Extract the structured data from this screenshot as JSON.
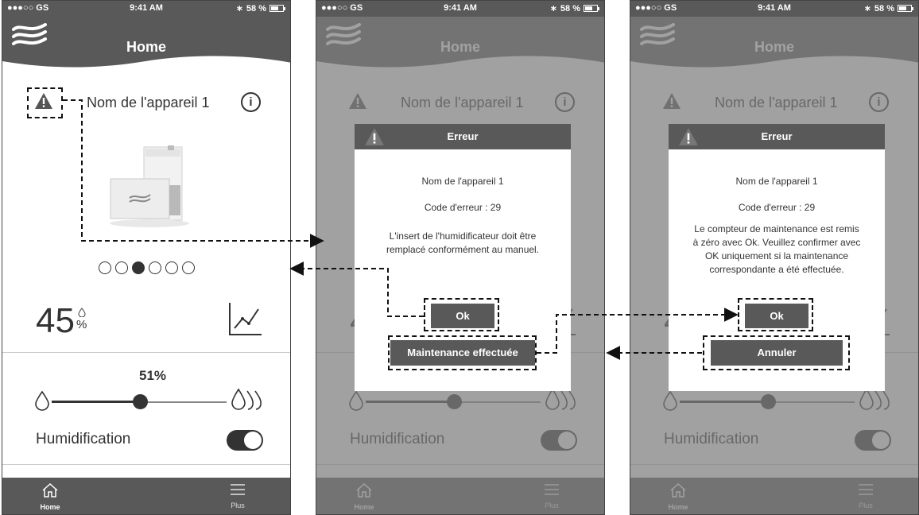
{
  "status": {
    "carrier": "●●●○○ GS",
    "time": "9:41 AM",
    "battery": "58 %"
  },
  "header": {
    "title": "Home"
  },
  "device": {
    "name": "Nom de l'appareil 1",
    "info_label": "i"
  },
  "carousel": {
    "count": 6,
    "active_index": 2
  },
  "humidity": {
    "value": "45",
    "unit": "%"
  },
  "setpoint": {
    "label": "51%",
    "fraction": 0.51
  },
  "humidification": {
    "label": "Humidification",
    "enabled": true
  },
  "tabbar": {
    "home": "Home",
    "plus": "Plus"
  },
  "dialog_a": {
    "title": "Erreur",
    "device": "Nom de l'appareil 1",
    "code": "Code d'erreur : 29",
    "message_line1": "L'insert de l'humidificateur doit être",
    "message_line2": "remplacé conformément au manuel.",
    "ok_button": "Ok",
    "maintenance_button": "Maintenance effectuée"
  },
  "dialog_b": {
    "title": "Erreur",
    "device": "Nom de l'appareil 1",
    "code": "Code d'erreur : 29",
    "message_line1": "Le compteur de maintenance est remis",
    "message_line2": "à zéro avec Ok. Veuillez confirmer avec",
    "message_line3": "OK uniquement si la maintenance",
    "message_line4": "correspondante a été effectuée.",
    "ok_button": "Ok",
    "cancel_button": "Annuler"
  },
  "colors": {
    "bar": "#595959",
    "text": "#333333",
    "dim": "#7d7d7d"
  },
  "icons": [
    "wave-logo-icon",
    "warning-icon",
    "info-icon",
    "chart-icon",
    "drop-icon",
    "drops-icon",
    "home-icon",
    "menu-icon"
  ]
}
